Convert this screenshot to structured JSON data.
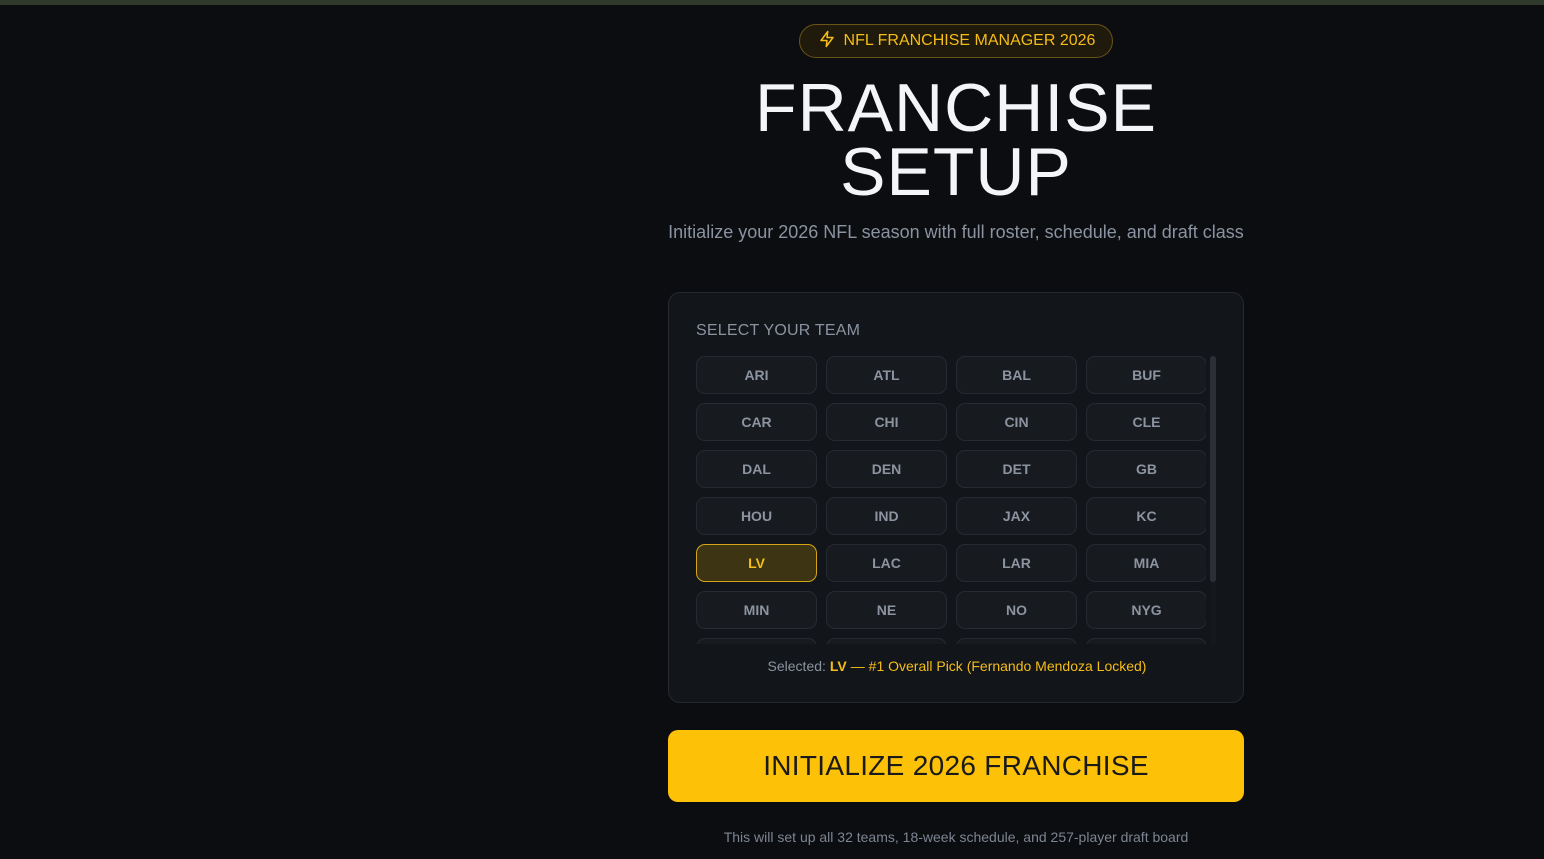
{
  "header": {
    "badge_label": "NFL FRANCHISE MANAGER 2026",
    "badge_icon": "lightning-icon",
    "title_line1": "FRANCHISE",
    "title_line2": "SETUP",
    "subtitle": "Initialize your 2026 NFL season with full roster, schedule, and draft class"
  },
  "team_select": {
    "label": "SELECT YOUR TEAM",
    "teams": [
      "ARI",
      "ATL",
      "BAL",
      "BUF",
      "CAR",
      "CHI",
      "CIN",
      "CLE",
      "DAL",
      "DEN",
      "DET",
      "GB",
      "HOU",
      "IND",
      "JAX",
      "KC",
      "LV",
      "LAC",
      "LAR",
      "MIA",
      "MIN",
      "NE",
      "NO",
      "NYG",
      "",
      "",
      "",
      ""
    ],
    "selected_team": "LV",
    "selected_prefix": "Selected:",
    "selected_note": "— #1 Overall Pick (Fernando Mendoza Locked)"
  },
  "actions": {
    "initialize_label": "INITIALIZE 2026 FRANCHISE",
    "footnote": "This will set up all 32 teams, 18-week schedule, and 257-player draft board"
  },
  "colors": {
    "background": "#0b0d10",
    "accent": "#fdc107",
    "selected_text": "#f5bd17"
  }
}
